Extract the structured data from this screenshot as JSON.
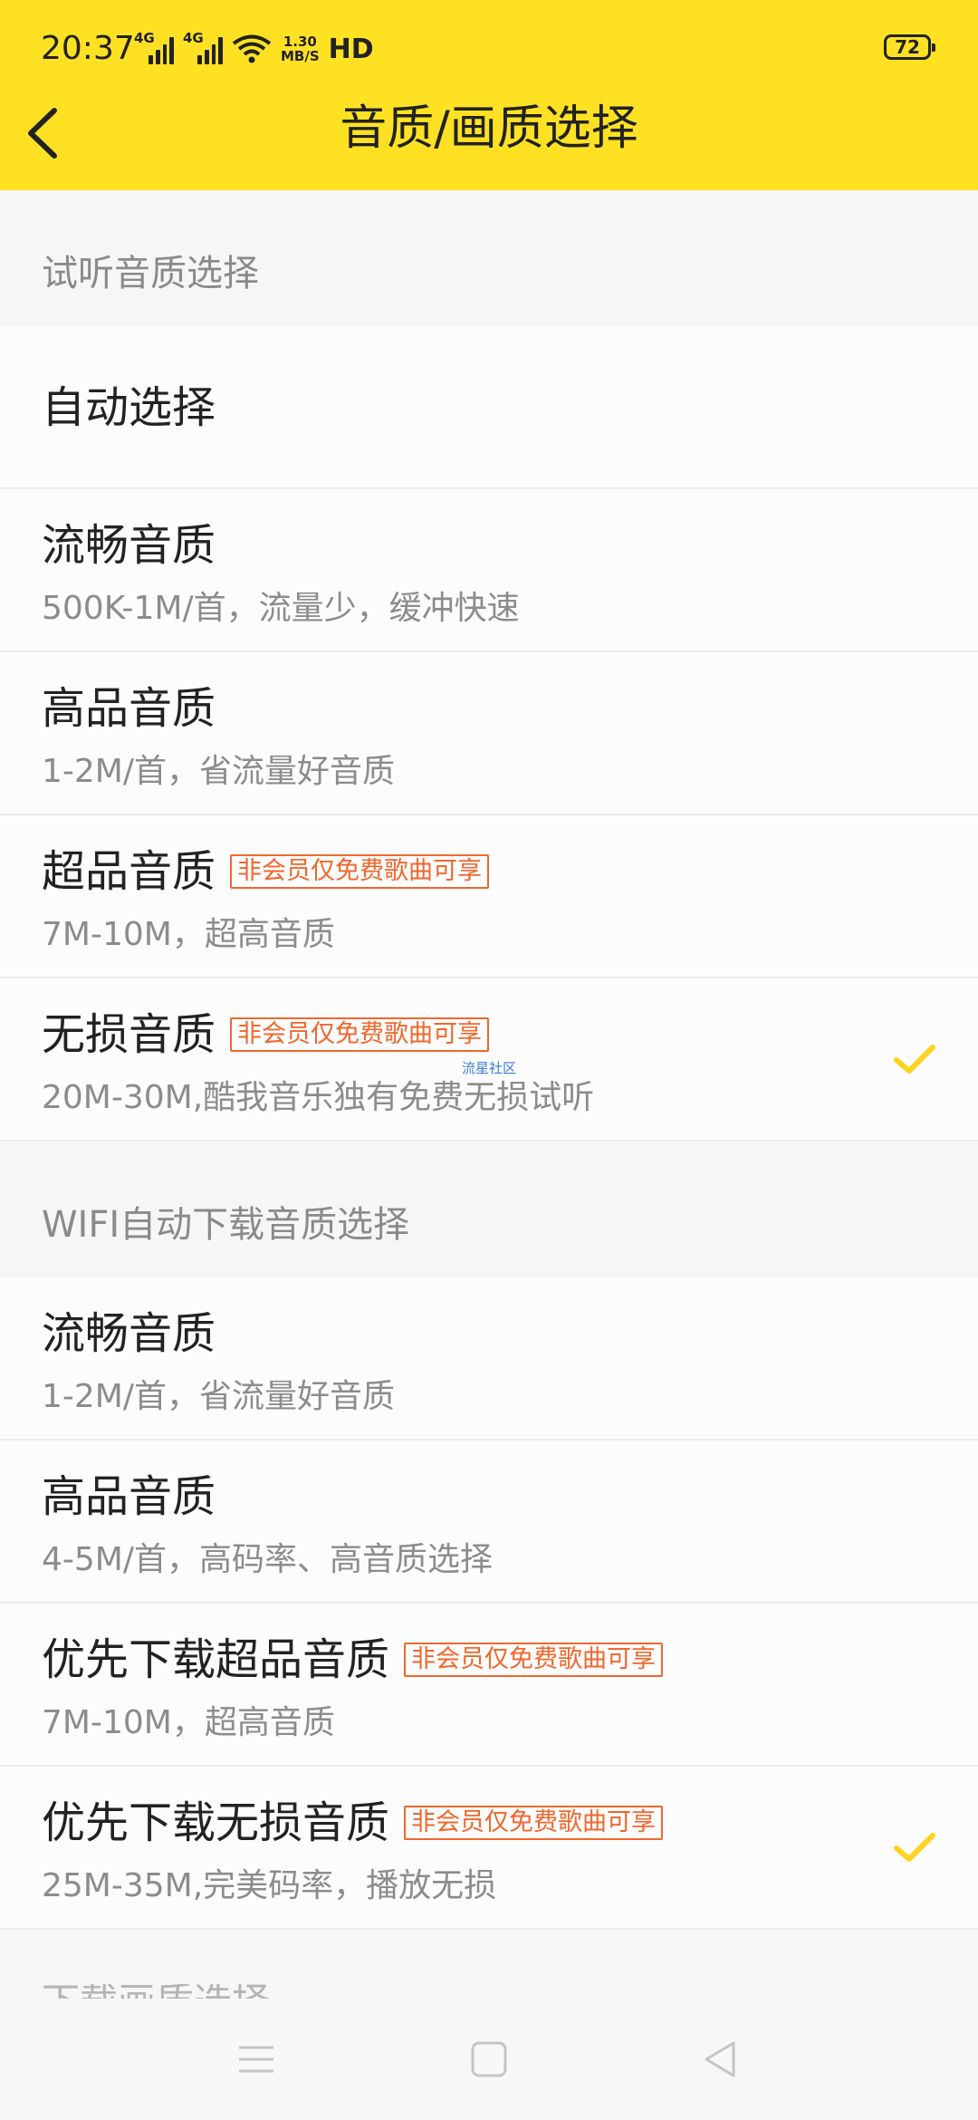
{
  "status_bar": {
    "time": "20:37",
    "signal1_label": "4G",
    "signal2_label": "4G",
    "speed_value": "1.30",
    "speed_unit": "MB/S",
    "hd_label": "HD",
    "battery": "72"
  },
  "header": {
    "title": "音质/画质选择",
    "back_icon": "chevron-left-icon",
    "background_color": "#ffe124"
  },
  "section_listen": {
    "header": "试听音质选择",
    "items": [
      {
        "title": "自动选择",
        "subtitle": ""
      },
      {
        "title": "流畅音质",
        "subtitle": "500K-1M/首，流量少，缓冲快速"
      },
      {
        "title": "高品音质",
        "subtitle": "1-2M/首，省流量好音质"
      },
      {
        "title": "超品音质",
        "tag": "非会员仅免费歌曲可享",
        "subtitle": "7M-10M，超高音质"
      },
      {
        "title": "无损音质",
        "tag": "非会员仅免费歌曲可享",
        "subtitle": "20M-30M,酷我音乐独有免费无损试听",
        "selected": true,
        "watermark": "流星社区"
      }
    ]
  },
  "section_wifi": {
    "header": "WIFI自动下载音质选择",
    "items": [
      {
        "title": "流畅音质",
        "subtitle": "1-2M/首，省流量好音质"
      },
      {
        "title": "高品音质",
        "subtitle": "4-5M/首，高码率、高音质选择"
      },
      {
        "title": "优先下载超品音质",
        "tag": "非会员仅免费歌曲可享",
        "subtitle": "7M-10M，超高音质"
      },
      {
        "title": "优先下载无损音质",
        "tag": "非会员仅免费歌曲可享",
        "subtitle": "25M-35M,完美码率，播放无损",
        "selected": true
      }
    ]
  },
  "section_next_peek": "下载画质选择",
  "colors": {
    "accent_check": "#ffd21e",
    "tag": "#f0672c"
  },
  "nav_icons": [
    "menu-icon",
    "home-square-icon",
    "back-triangle-icon"
  ]
}
